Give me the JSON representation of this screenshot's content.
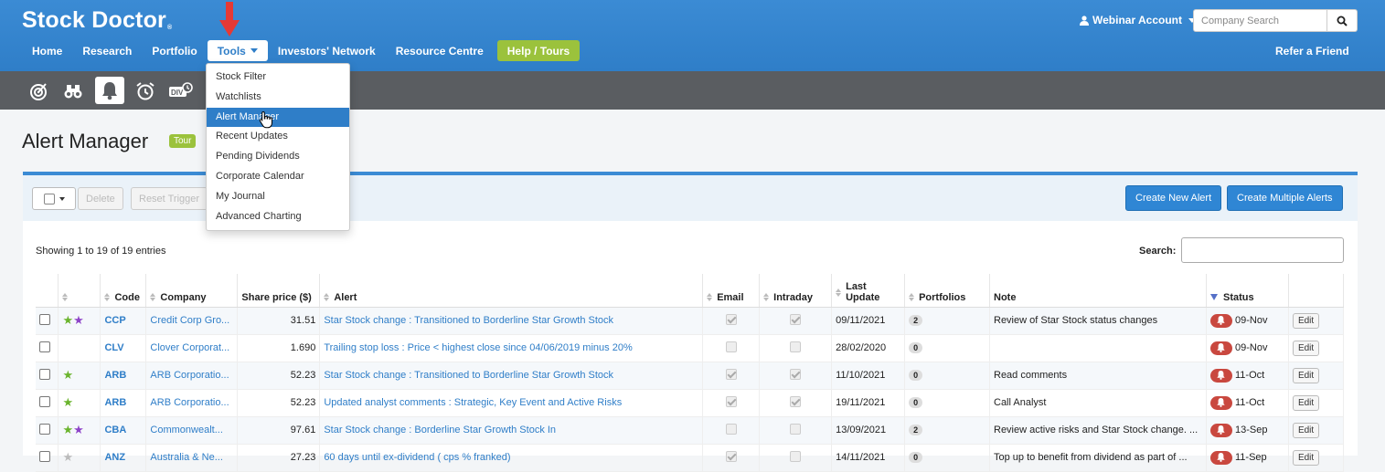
{
  "app": {
    "logo": "Stock Doctor",
    "logo_mark": "®"
  },
  "header": {
    "account_label": "Webinar Account",
    "search_placeholder": "Company Search",
    "refer_label": "Refer a Friend"
  },
  "nav": {
    "items": [
      "Home",
      "Research",
      "Portfolio",
      "Tools",
      "Investors' Network",
      "Resource Centre",
      "Help / Tours"
    ],
    "active": "Tools"
  },
  "tools_menu": {
    "items": [
      "Stock Filter",
      "Watchlists",
      "Alert Manager",
      "Recent Updates",
      "Pending Dividends",
      "Corporate Calendar",
      "My Journal",
      "Advanced Charting"
    ],
    "selected": "Alert Manager"
  },
  "toolbar": {
    "icons": [
      "target-icon",
      "binoculars-icon",
      "bell-icon",
      "alarm-clock-icon",
      "dividend-icon"
    ],
    "active": "bell-icon"
  },
  "page": {
    "title": "Alert Manager",
    "tour_badge": "Tour"
  },
  "actions": {
    "delete": "Delete",
    "reset": "Reset Trigger",
    "create_new": "Create New Alert",
    "create_multiple": "Create Multiple Alerts"
  },
  "table": {
    "showing": "Showing 1 to 19 of 19 entries",
    "search_label": "Search:",
    "columns": [
      "",
      "",
      "Code",
      "Company",
      "Share price ($)",
      "Alert",
      "Email",
      "Intraday",
      "Last Update",
      "Portfolios",
      "Note",
      "Status",
      ""
    ],
    "rows": [
      {
        "stars": [
          "green",
          "purple"
        ],
        "code": "CCP",
        "company": "Credit Corp Gro...",
        "price": "31.51",
        "alert": "Star Stock change : Transitioned to Borderline Star Growth Stock",
        "email": true,
        "intraday": true,
        "updated": "09/11/2021",
        "portfolios": "2",
        "note": "Review of Star Stock status changes",
        "status": "09-Nov",
        "edit": "Edit"
      },
      {
        "stars": [],
        "code": "CLV",
        "company": "Clover Corporat...",
        "price": "1.690",
        "alert": "Trailing stop loss : Price < highest close since 04/06/2019 minus 20%",
        "email": false,
        "intraday": false,
        "updated": "28/02/2020",
        "portfolios": "0",
        "note": "",
        "status": "09-Nov",
        "edit": "Edit"
      },
      {
        "stars": [
          "green"
        ],
        "code": "ARB",
        "company": "ARB Corporatio...",
        "price": "52.23",
        "alert": "Star Stock change : Transitioned to Borderline Star Growth Stock",
        "email": true,
        "intraday": true,
        "updated": "11/10/2021",
        "portfolios": "0",
        "note": "Read comments",
        "status": "11-Oct",
        "edit": "Edit"
      },
      {
        "stars": [
          "green"
        ],
        "code": "ARB",
        "company": "ARB Corporatio...",
        "price": "52.23",
        "alert": "Updated analyst comments : Strategic, Key Event and Active Risks",
        "email": true,
        "intraday": true,
        "updated": "19/11/2021",
        "portfolios": "0",
        "note": "Call Analyst",
        "status": "11-Oct",
        "edit": "Edit"
      },
      {
        "stars": [
          "green",
          "purple"
        ],
        "code": "CBA",
        "company": "Commonwealt...",
        "price": "97.61",
        "alert": "Star Stock change : Borderline Star Growth Stock In",
        "email": false,
        "intraday": false,
        "updated": "13/09/2021",
        "portfolios": "2",
        "note": "Review active risks and Star Stock change. ...",
        "status": "13-Sep",
        "edit": "Edit"
      },
      {
        "stars": [
          "grey"
        ],
        "code": "ANZ",
        "company": "Australia & Ne...",
        "price": "27.23",
        "alert": "60 days until ex-dividend ( cps % franked)",
        "email": true,
        "intraday": false,
        "updated": "14/11/2021",
        "portfolios": "0",
        "note": "Top up to benefit from dividend as part of ...",
        "status": "11-Sep",
        "edit": "Edit"
      }
    ]
  },
  "colors": {
    "brand_blue": "#2f7ec8",
    "toolbar_grey": "#5a5d61",
    "help_green": "#9bc23c",
    "alert_red": "#c9483f",
    "star_green": "#6ab42d",
    "star_purple": "#8e44c8",
    "star_grey": "#bbbbbb"
  }
}
